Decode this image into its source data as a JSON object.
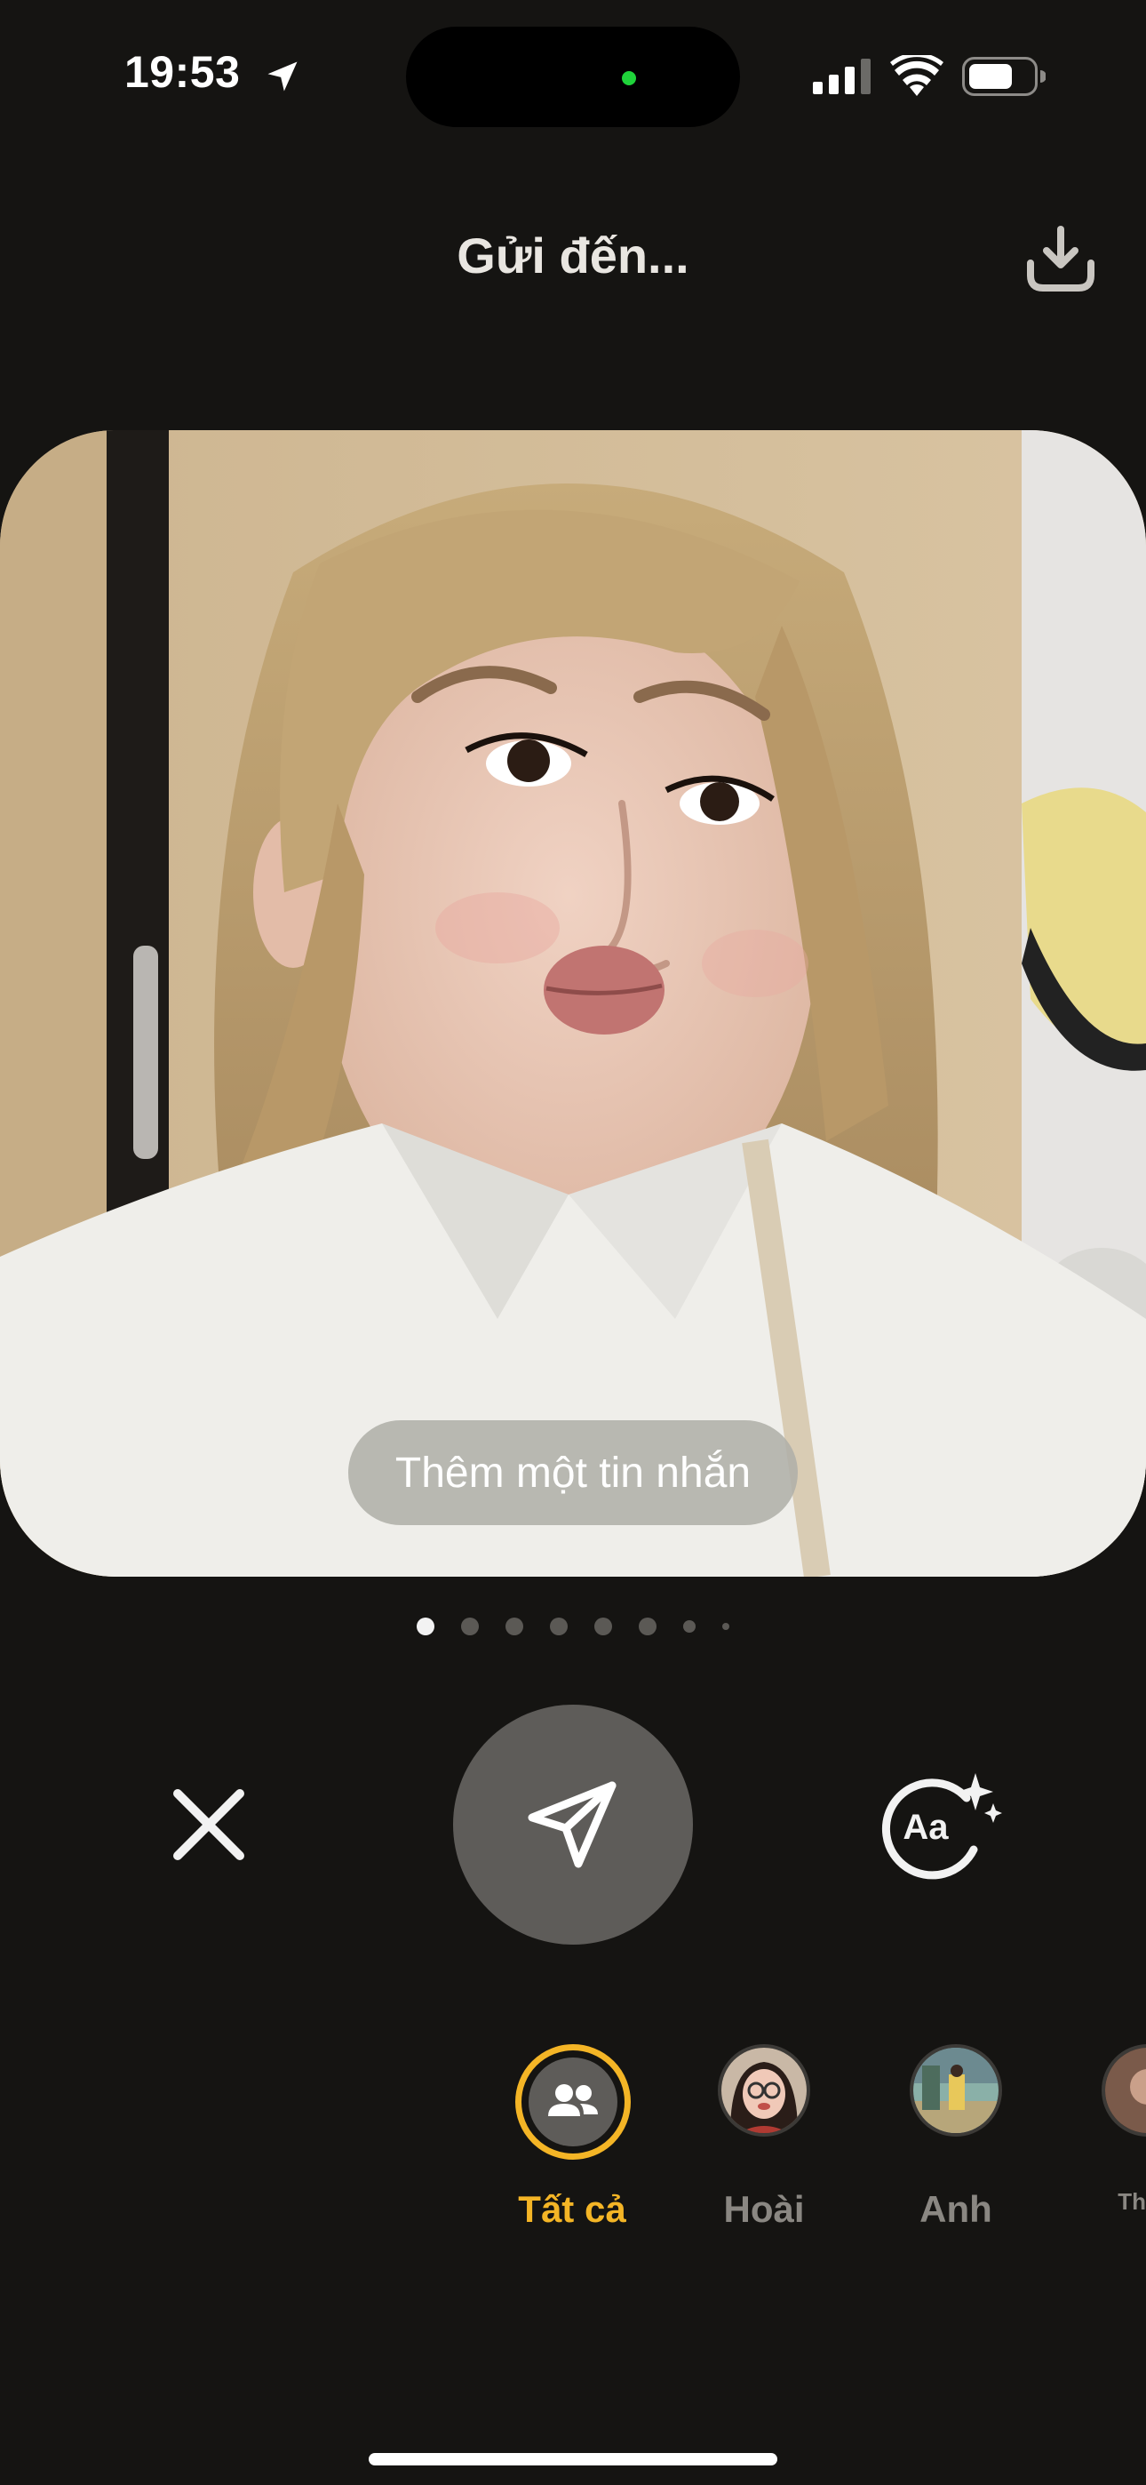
{
  "status_bar": {
    "time": "19:53",
    "icons": [
      "location-arrow-icon",
      "cellular-signal-icon",
      "wifi-icon",
      "battery-icon"
    ],
    "camera_indicator_color": "#1fd33a"
  },
  "header": {
    "title": "Gửi đến...",
    "download_icon": "download-icon"
  },
  "photo": {
    "message_placeholder": "Thêm một tin nhắn"
  },
  "pager": {
    "count": 8,
    "active_index": 0
  },
  "controls": {
    "close_icon": "close-icon",
    "send_icon": "paper-plane-icon",
    "text_effects_icon": "aa-sparkles-icon"
  },
  "recipients": [
    {
      "label": "Tất cả",
      "icon": "group-icon",
      "selected": true
    },
    {
      "label": "Hoài",
      "icon": "avatar",
      "selected": false
    },
    {
      "label": "Anh",
      "icon": "avatar",
      "selected": false
    },
    {
      "label": "Th",
      "icon": "avatar",
      "selected": false
    }
  ],
  "colors": {
    "background": "#151412",
    "accent": "#f4b526",
    "send_button": "#5e5c59"
  }
}
